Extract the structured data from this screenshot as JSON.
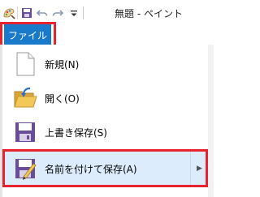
{
  "window": {
    "title": "無題 - ペイント"
  },
  "quick_access": {
    "icons": [
      "paint-app-icon",
      "save-icon",
      "undo-icon",
      "redo-icon",
      "customize-qat-dropdown-icon"
    ]
  },
  "ribbon": {
    "file_tab_label": "ファイル"
  },
  "file_menu": {
    "items": [
      {
        "label": "新規(N)",
        "icon": "new-document-icon"
      },
      {
        "label": "開く(O)",
        "icon": "open-folder-icon"
      },
      {
        "label": "上書き保存(S)",
        "icon": "save-icon"
      },
      {
        "label": "名前を付けて保存(A)",
        "icon": "save-as-icon",
        "has_submenu": true,
        "highlighted": true
      }
    ]
  },
  "colors": {
    "file_tab_bg": "#1979ca",
    "highlight_border": "#e8232f",
    "hover_bg": "#dcecfc"
  }
}
